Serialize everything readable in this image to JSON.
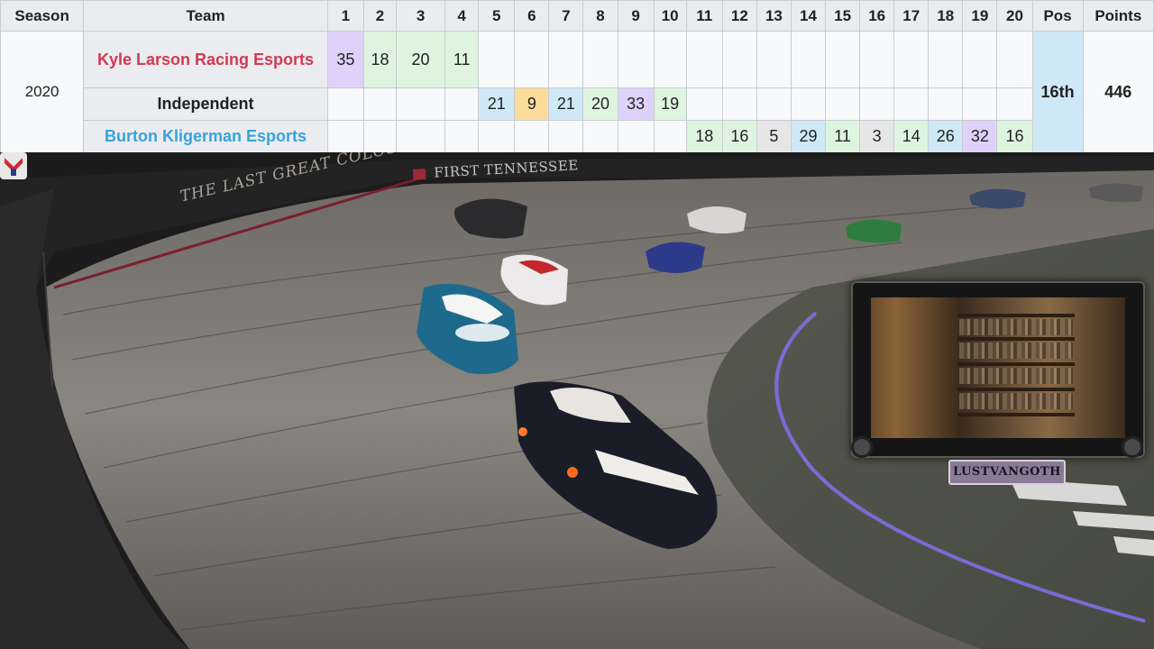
{
  "table": {
    "headers": [
      "Season",
      "Team",
      "1",
      "2",
      "3",
      "4",
      "5",
      "6",
      "7",
      "8",
      "9",
      "10",
      "11",
      "12",
      "13",
      "14",
      "15",
      "16",
      "17",
      "18",
      "19",
      "20",
      "Pos",
      "Points"
    ],
    "season": "2020",
    "teams": [
      {
        "name": "Kyle Larson Racing Esports",
        "color": "#d33852"
      },
      {
        "name": "Independent",
        "color": "#202122"
      },
      {
        "name": "Burton Kligerman Esports",
        "color": "#36a3d9"
      }
    ],
    "rows": [
      [
        "35",
        "18",
        "20",
        "11",
        "",
        "",
        "",
        "",
        "",
        "",
        "",
        "",
        "",
        "",
        "",
        "",
        "",
        "",
        "",
        ""
      ],
      [
        "",
        "",
        "",
        "",
        "21",
        "9",
        "21",
        "20",
        "33",
        "19",
        "",
        "",
        "",
        "",
        "",
        "",
        "",
        "",
        "",
        ""
      ],
      [
        "",
        "",
        "",
        "",
        "",
        "",
        "",
        "",
        "",
        "",
        "18",
        "16",
        "5",
        "29",
        "11",
        "3",
        "14",
        "26",
        "32",
        "16"
      ]
    ],
    "cell_colors": [
      [
        "#dfd2fa",
        "#dff4df",
        "#dff4df",
        "#dff4df",
        "",
        "",
        "",
        "",
        "",
        "",
        "",
        "",
        "",
        "",
        "",
        "",
        "",
        "",
        "",
        ""
      ],
      [
        "",
        "",
        "",
        "",
        "#cfe8f6",
        "#fbdc9b",
        "#cfe8f6",
        "#dff4df",
        "#dfd2fa",
        "#dff4df",
        "",
        "",
        "",
        "",
        "",
        "",
        "",
        "",
        "",
        ""
      ],
      [
        "",
        "",
        "",
        "",
        "",
        "",
        "",
        "",
        "",
        "",
        "#dff4df",
        "#dff4df",
        "#e6e6e6",
        "#cfe8f6",
        "#dff4df",
        "#e6e6e6",
        "#dff4df",
        "#cfe8f6",
        "#dfd2fa",
        "#dff4df"
      ]
    ],
    "position": "16th",
    "points": "446"
  },
  "scene": {
    "wall_text": "THE LAST GREAT COLOSSEUM",
    "sponsor_text": "FIRST TENNESSEE",
    "webcam_name": "LUSTVANGOTH",
    "accent_track_line": "#7b6bd6"
  }
}
